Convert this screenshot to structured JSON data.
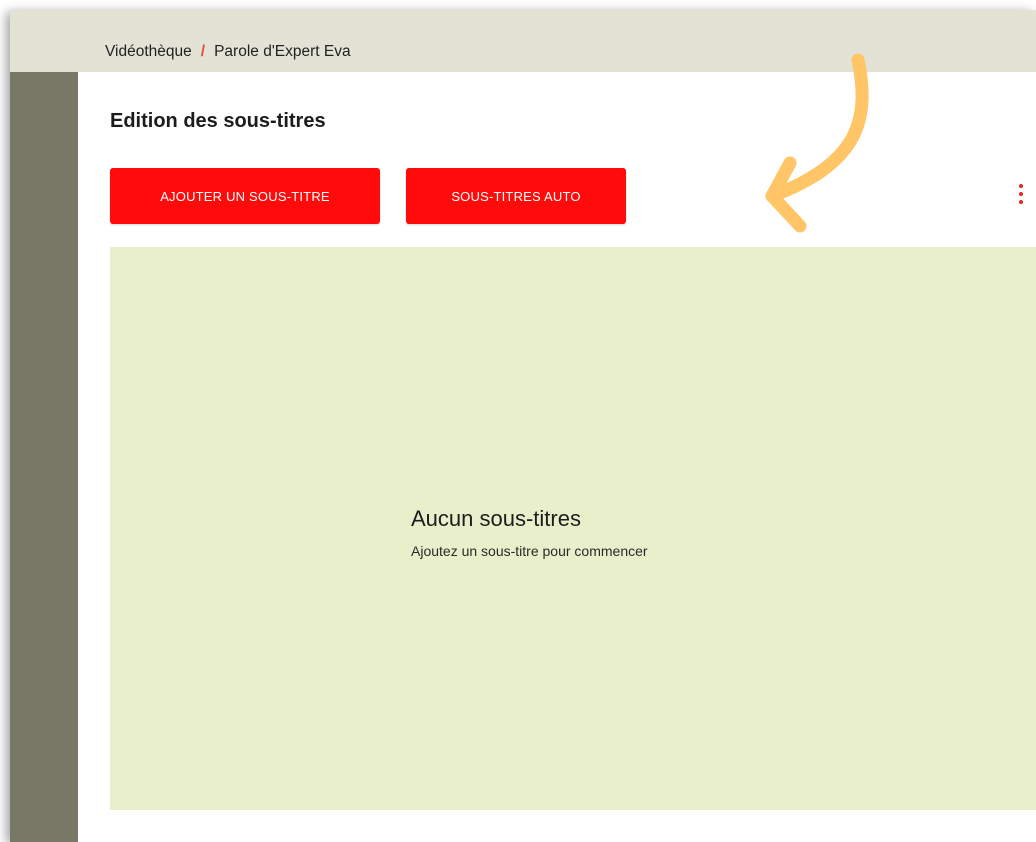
{
  "breadcrumb": {
    "root": "Vidéothèque",
    "separator": "/",
    "current": "Parole d'Expert Eva"
  },
  "dialog": {
    "title": "Edition des sous-titres",
    "buttons": {
      "add_subtitle": "AJOUTER UN SOUS-TITRE",
      "auto_subtitles": "SOUS-TITRES AUTO"
    },
    "menu_icon": "more-vertical-icon",
    "empty_state": {
      "title": "Aucun sous-titres",
      "subtitle": "Ajoutez un sous-titre pour commencer"
    }
  },
  "annotation": {
    "icon": "curved-arrow-icon",
    "color": "#ffc566"
  },
  "colors": {
    "accent": "#ff0b0b",
    "empty_background": "#e9efcb",
    "overlay": "#777866"
  }
}
